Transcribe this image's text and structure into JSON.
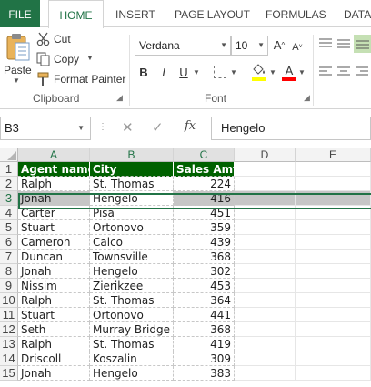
{
  "tabs": [
    "FILE",
    "HOME",
    "INSERT",
    "PAGE LAYOUT",
    "FORMULAS",
    "DATA"
  ],
  "active_tab": "HOME",
  "clipboard": {
    "paste": "Paste",
    "cut": "Cut",
    "copy": "Copy",
    "format_painter": "Format Painter",
    "group_label": "Clipboard"
  },
  "font": {
    "name": "Verdana",
    "size": "10",
    "group_label": "Font",
    "bold": "B",
    "italic": "I",
    "underline": "U",
    "grow": "A",
    "shrink": "A",
    "font_color_letter": "A"
  },
  "formula_bar": {
    "name_box": "B3",
    "fx": "fx",
    "value": "Hengelo"
  },
  "columns": [
    "A",
    "B",
    "C",
    "D",
    "E"
  ],
  "rows": [
    "1",
    "2",
    "3",
    "4",
    "5",
    "6",
    "7",
    "8",
    "9",
    "10",
    "11",
    "12",
    "13",
    "14",
    "15"
  ],
  "table": {
    "headers": [
      "Agent name",
      "City",
      "Sales Amt"
    ],
    "data": [
      [
        "Ralph",
        "St. Thomas",
        "224"
      ],
      [
        "Jonah",
        "Hengelo",
        "416"
      ],
      [
        "Carter",
        "Pisa",
        "451"
      ],
      [
        "Stuart",
        "Ortonovo",
        "359"
      ],
      [
        "Cameron",
        "Calco",
        "439"
      ],
      [
        "Duncan",
        "Townsville",
        "368"
      ],
      [
        "Jonah",
        "Hengelo",
        "302"
      ],
      [
        "Nissim",
        "Zierikzee",
        "453"
      ],
      [
        "Ralph",
        "St. Thomas",
        "364"
      ],
      [
        "Stuart",
        "Ortonovo",
        "441"
      ],
      [
        "Seth",
        "Murray Bridge",
        "368"
      ],
      [
        "Ralph",
        "St. Thomas",
        "419"
      ],
      [
        "Driscoll",
        "Koszalin",
        "309"
      ],
      [
        "Jonah",
        "Hengelo",
        "383"
      ]
    ]
  },
  "colors": {
    "accent": "#217346",
    "header_fill": "#006100",
    "selection_fill": "#c6c6c6"
  }
}
